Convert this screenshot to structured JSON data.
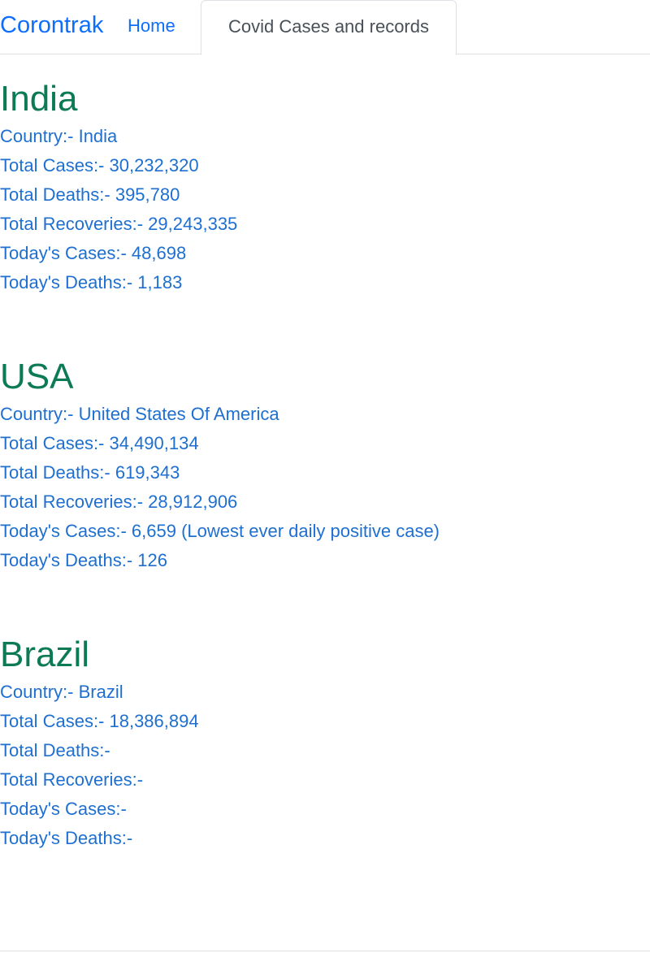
{
  "navbar": {
    "brand": "Corontrak",
    "home_label": "Home",
    "active_tab_label": "Covid Cases and records"
  },
  "countries": [
    {
      "heading": "India",
      "country_line": "Country:- India",
      "total_cases_line": "Total Cases:- 30,232,320",
      "total_deaths_line": "Total Deaths:- 395,780",
      "total_recoveries_line": "Total Recoveries:- 29,243,335",
      "todays_cases_line": "Today's Cases:- 48,698",
      "todays_deaths_line": "Today's Deaths:- 1,183"
    },
    {
      "heading": "USA",
      "country_line": "Country:- United States Of America",
      "total_cases_line": "Total Cases:- 34,490,134",
      "total_deaths_line": "Total Deaths:- 619,343",
      "total_recoveries_line": "Total Recoveries:- 28,912,906",
      "todays_cases_line": "Today's Cases:- 6,659 (Lowest ever daily positive case)",
      "todays_deaths_line": "Today's Deaths:- 126"
    },
    {
      "heading": "Brazil",
      "country_line": "Country:- Brazil",
      "total_cases_line": "Total Cases:- 18,386,894",
      "total_deaths_line": "Total Deaths:-",
      "total_recoveries_line": "Total Recoveries:-",
      "todays_cases_line": "Today's Cases:-",
      "todays_deaths_line": "Today's Deaths:-"
    }
  ],
  "colors": {
    "brand": "#0d6efd",
    "heading": "#0b7a55",
    "stat_text": "#1e6fd0",
    "tab_text": "#495057",
    "border": "#dee2e6"
  }
}
